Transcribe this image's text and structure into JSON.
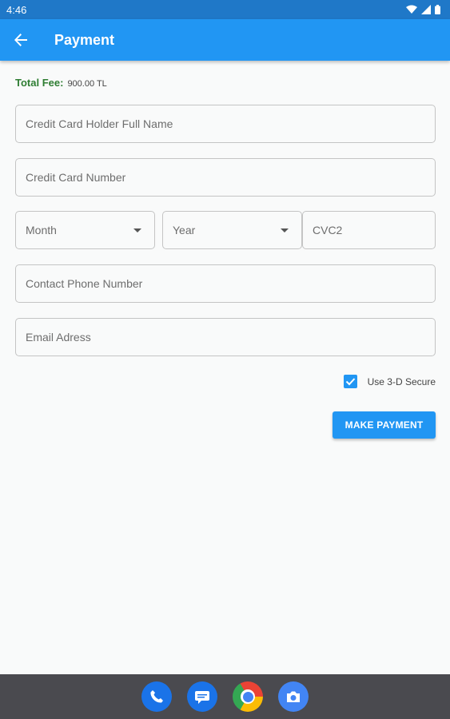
{
  "status_bar": {
    "time": "4:46"
  },
  "app_bar": {
    "title": "Payment"
  },
  "total_fee": {
    "label": "Total Fee:",
    "value": "900.00 TL"
  },
  "form": {
    "holder_name": {
      "placeholder": "Credit Card Holder Full Name"
    },
    "card_number": {
      "placeholder": "Credit Card Number"
    },
    "month": {
      "label": "Month"
    },
    "year": {
      "label": "Year"
    },
    "cvc": {
      "placeholder": "CVC2"
    },
    "phone": {
      "placeholder": "Contact Phone Number"
    },
    "email": {
      "placeholder": "Email Adress"
    },
    "secure": {
      "label": "Use 3-D Secure",
      "checked": true
    },
    "submit_label": "MAKE PAYMENT"
  },
  "dock": {
    "apps": [
      "phone-icon",
      "messages-icon",
      "chrome-icon",
      "camera-icon"
    ]
  },
  "colors": {
    "primary": "#2196f3",
    "status_bar": "#1f78c8",
    "fee_label": "#2e7d32",
    "nav_bar": "#4a4a4f"
  }
}
